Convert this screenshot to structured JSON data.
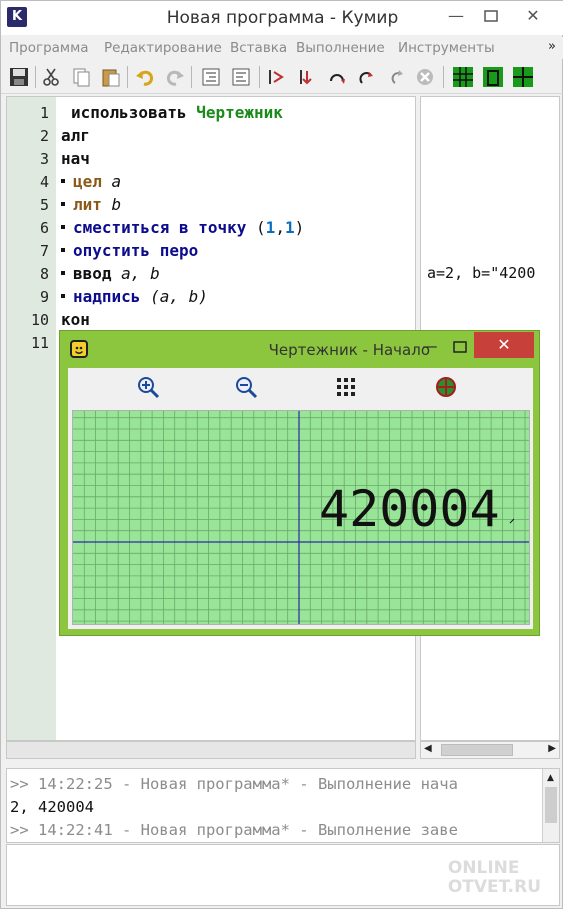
{
  "window": {
    "title": "Новая программа - Кумир",
    "app_icon": "K",
    "min_label": "—",
    "max_label": "☐",
    "close_label": "✕"
  },
  "menu": {
    "items": [
      "Программа",
      "Редактирование",
      "Вставка",
      "Выполнение",
      "Инструменты"
    ],
    "more": "»"
  },
  "toolbar": {
    "icons": [
      "save-icon",
      "cut-icon",
      "copy-icon",
      "paste-icon",
      "undo-icon",
      "redo-icon",
      "indent-icon",
      "unindent-icon",
      "run-icon",
      "run-step-icon",
      "step-in-icon",
      "step-over-icon",
      "step-out-icon",
      "stop-icon",
      "layout-grid-icon",
      "layout-window-icon",
      "layout-split-icon"
    ]
  },
  "editor": {
    "line_numbers": [
      "1",
      "2",
      "3",
      "4",
      "5",
      "6",
      "7",
      "8",
      "9",
      "10",
      "11"
    ],
    "lines": {
      "l1": {
        "kw": "использовать",
        "name": "Чертежник"
      },
      "l2": {
        "kw": "алг"
      },
      "l3": {
        "kw": "нач"
      },
      "l4": {
        "kw": "цел",
        "var": "a"
      },
      "l5": {
        "kw": "лит",
        "var": "b"
      },
      "l6": {
        "kw": "сместиться в точку",
        "open": "(",
        "n1": "1",
        "comma": ",",
        "n2": "1",
        "close": ")"
      },
      "l7": {
        "kw": "опустить перо"
      },
      "l8": {
        "kw": "ввод",
        "args": "a, b"
      },
      "l9": {
        "kw": "надпись",
        "args": "(a, b)"
      },
      "l10": {
        "kw": "кон"
      }
    }
  },
  "margin": {
    "values": "a=2, b=\"4200"
  },
  "console": {
    "line1": ">> 14:22:25 - Новая программа* - Выполнение нача",
    "line2": "2, 420004",
    "line3": ">> 14:22:41 - Новая программа* - Выполнение заве"
  },
  "watermark": {
    "line1": "ONLINE",
    "line2": "OTVET.RU"
  },
  "drawer": {
    "title": "Чертежник - Начало",
    "min_label": "—",
    "close_label": "✕",
    "toolbar_icons": [
      "zoom-in-icon",
      "zoom-out-icon",
      "grid-icon",
      "fit-view-icon"
    ],
    "canvas_text": "420004",
    "grid_color": "#6aa86a",
    "background": "#98e598",
    "axis_color": "#2a2aa6"
  },
  "colors": {
    "gutter": "#dfe9df",
    "drawer_frame": "#8cc63e",
    "close_red": "#c7403a"
  }
}
